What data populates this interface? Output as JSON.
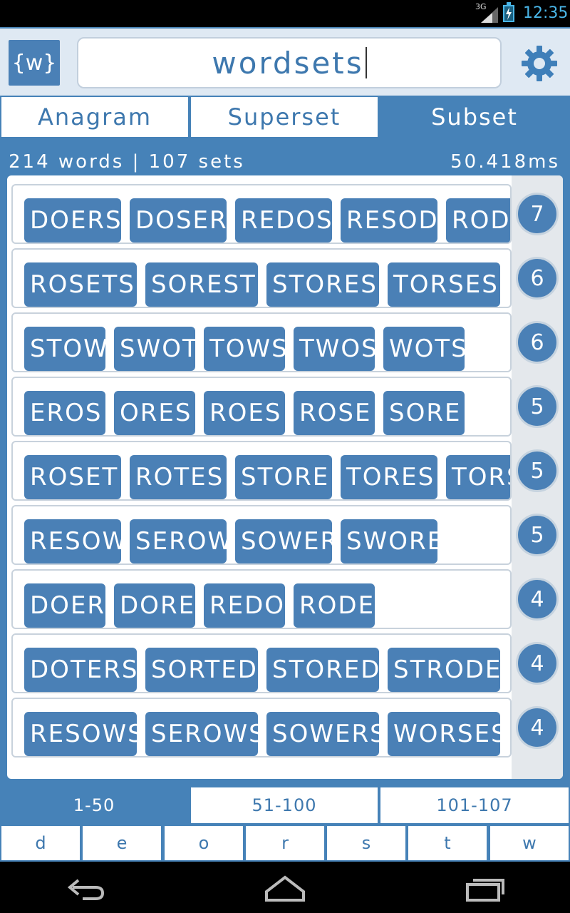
{
  "status_bar": {
    "network": "3G",
    "time": "12:35"
  },
  "header": {
    "logo_text": "{w}",
    "search_value": "wordsets",
    "settings_icon": "gear-icon"
  },
  "mode_tabs": [
    {
      "label": "Anagram",
      "active": false
    },
    {
      "label": "Superset",
      "active": false
    },
    {
      "label": "Subset",
      "active": true
    }
  ],
  "stats": {
    "summary": "214 words | 107 sets",
    "time": "50.418ms"
  },
  "result_sets": [
    {
      "count": "7",
      "words": [
        "DOERS",
        "DOSER",
        "REDOS",
        "RESOD",
        "RODES"
      ]
    },
    {
      "count": "6",
      "words": [
        "ROSETS",
        "SOREST",
        "STORES",
        "TORSES"
      ]
    },
    {
      "count": "6",
      "words": [
        "STOW",
        "SWOT",
        "TOWS",
        "TWOS",
        "WOTS"
      ]
    },
    {
      "count": "5",
      "words": [
        "EROS",
        "ORES",
        "ROES",
        "ROSE",
        "SORE"
      ]
    },
    {
      "count": "5",
      "words": [
        "ROSET",
        "ROTES",
        "STORE",
        "TORES",
        "TORSE"
      ]
    },
    {
      "count": "5",
      "words": [
        "RESOW",
        "SEROW",
        "SOWER",
        "SWORE"
      ]
    },
    {
      "count": "4",
      "words": [
        "DOER",
        "DORE",
        "REDO",
        "RODE"
      ]
    },
    {
      "count": "4",
      "words": [
        "DOTERS",
        "SORTED",
        "STORED",
        "STRODE"
      ]
    },
    {
      "count": "4",
      "words": [
        "RESOWS",
        "SEROWS",
        "SOWERS",
        "WORSES"
      ]
    }
  ],
  "page_tabs": [
    {
      "label": "1-50",
      "active": true
    },
    {
      "label": "51-100",
      "active": false
    },
    {
      "label": "101-107",
      "active": false
    }
  ],
  "letters": [
    "d",
    "e",
    "o",
    "r",
    "s",
    "t",
    "w"
  ],
  "nav": {
    "back_icon": "back-icon",
    "home_icon": "home-icon",
    "recents_icon": "recents-icon"
  }
}
